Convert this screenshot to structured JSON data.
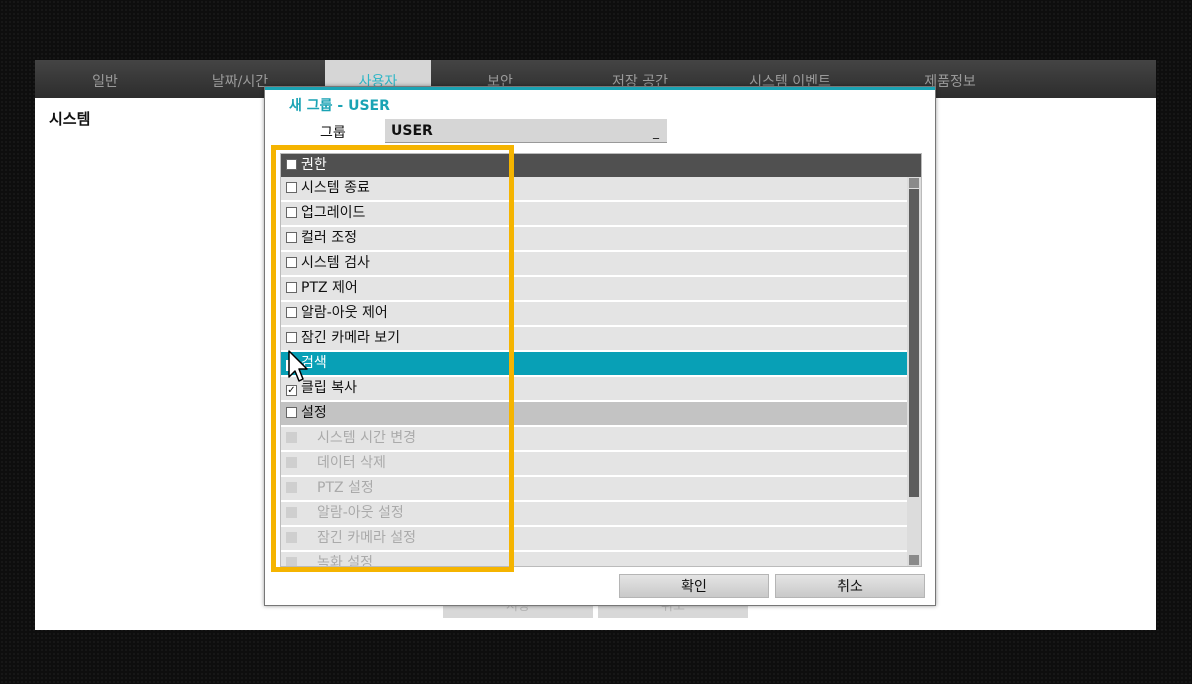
{
  "tabs": [
    {
      "label": "일반"
    },
    {
      "label": "날짜/시간"
    },
    {
      "label": "사용자"
    },
    {
      "label": "보안"
    },
    {
      "label": "저장 공간"
    },
    {
      "label": "시스템 이벤트"
    },
    {
      "label": "제품정보"
    }
  ],
  "background": {
    "sidebar_title": "시스템",
    "save_label": "저장",
    "cancel_label": "취소"
  },
  "dialog": {
    "title": "새 그룹 - USER",
    "group_label": "그룹",
    "group_value": "USER",
    "permissions_header": "권한",
    "permissions": [
      {
        "label": "시스템 종료",
        "checked": false,
        "state": "normal"
      },
      {
        "label": "업그레이드",
        "checked": false,
        "state": "normal"
      },
      {
        "label": "컬러 조정",
        "checked": false,
        "state": "normal"
      },
      {
        "label": "시스템 검사",
        "checked": false,
        "state": "normal"
      },
      {
        "label": "PTZ 제어",
        "checked": false,
        "state": "normal"
      },
      {
        "label": "알람-아웃 제어",
        "checked": false,
        "state": "normal"
      },
      {
        "label": "잠긴 카메라 보기",
        "checked": false,
        "state": "normal"
      },
      {
        "label": "검색",
        "checked": true,
        "state": "selected"
      },
      {
        "label": "클립 복사",
        "checked": true,
        "state": "normal"
      },
      {
        "label": "설정",
        "checked": false,
        "state": "section"
      },
      {
        "label": "시스템 시간 변경",
        "checked": false,
        "state": "disabled"
      },
      {
        "label": "데이터 삭제",
        "checked": false,
        "state": "disabled"
      },
      {
        "label": "PTZ 설정",
        "checked": false,
        "state": "disabled"
      },
      {
        "label": "알람-아웃 설정",
        "checked": false,
        "state": "disabled"
      },
      {
        "label": "잠긴 카메라 설정",
        "checked": false,
        "state": "disabled"
      },
      {
        "label": "녹화 설정",
        "checked": false,
        "state": "disabled"
      }
    ],
    "confirm_label": "확인",
    "cancel_label": "취소"
  },
  "colors": {
    "accent": "#1aa3b4",
    "selected_row": "#08a0b6",
    "highlight": "#f5b400"
  }
}
